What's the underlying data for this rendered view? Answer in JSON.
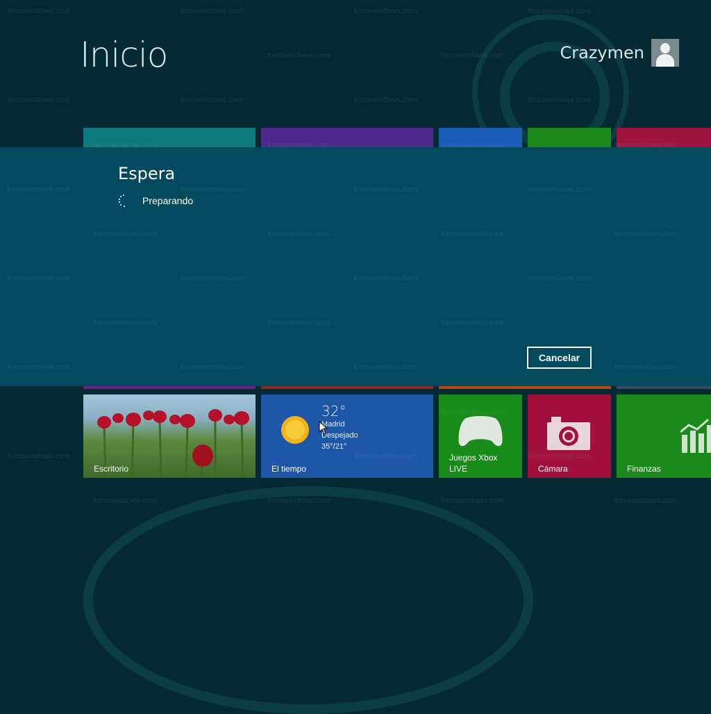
{
  "start": {
    "title": "Inicio",
    "user_name": "Crazymen",
    "avatar_icon": "user-icon"
  },
  "watermark": "foroswindows.com",
  "colors": {
    "background": "#062a33",
    "overlay": "#034a5e",
    "accent_text": "#d8e6e8"
  },
  "dialog": {
    "title": "Espera",
    "status": "Preparando",
    "spinner_icon": "loading-spinner-icon",
    "cancel_label": "Cancelar"
  },
  "tiles": [
    {
      "name": "Escritorio",
      "color": "#6a8b47",
      "icon": "tulips-image"
    },
    {
      "name": "El tiempo",
      "color": "#1f57a8",
      "icon": "sun-icon"
    },
    {
      "name": "Juegos Xbox LIVE",
      "color": "#178c18",
      "icon": "gamepad-icon"
    },
    {
      "name": "Cámara",
      "color": "#a1113c",
      "icon": "camera-icon"
    },
    {
      "name": "Finanzas",
      "color": "#1a8a1a",
      "icon": "chart-icon"
    }
  ],
  "weather": {
    "temp": "32°",
    "city": "Madrid",
    "condition": "Despejado",
    "range": "35°/21°"
  },
  "top_tiles": [
    {
      "color": "#0c7a7a"
    },
    {
      "color": "#4b2a8a"
    },
    {
      "color": "#1a5cb8"
    },
    {
      "color": "#1b8a1b"
    },
    {
      "color": "#a0153f"
    }
  ]
}
